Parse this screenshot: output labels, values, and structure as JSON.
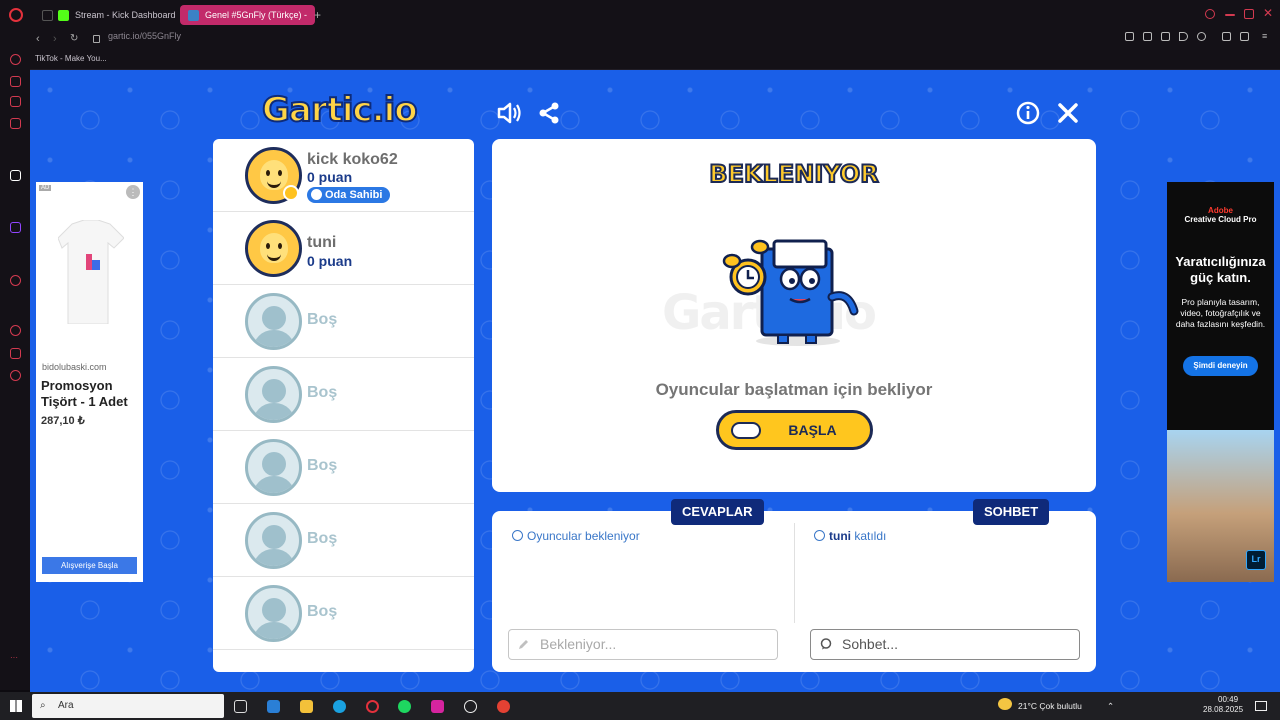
{
  "browser": {
    "tabs": [
      {
        "label": "Stream - Kick Dashboard",
        "favicon_color": "#53fc18"
      },
      {
        "label": "Genel #5GnFly (Türkçe) -",
        "favicon_color": "#3b82c6",
        "active": true
      }
    ],
    "url": "gartic.io/055GnFly",
    "bookmark": "TikTok - Make You..."
  },
  "game": {
    "logo_main": "Gartic",
    "logo_suffix": ".io",
    "players": [
      {
        "name": "kick koko62",
        "points": "0 puan",
        "badge": "Oda Sahibi"
      },
      {
        "name": "tuni",
        "points": "0 puan"
      }
    ],
    "empty_slot_label": "Boş",
    "status_title": "BEKLENIYOR",
    "waiting_text": "Oyuncular başlatman için bekliyor",
    "start_button": "BAŞLA",
    "answers_tab": "CEVAPLAR",
    "chat_tab": "SOHBET",
    "answers_info": "Oyuncular bekleniyor",
    "chat_info_user": "tuni",
    "chat_info_text": "katıldı",
    "answers_placeholder": "Bekleniyor...",
    "chat_placeholder": "Sohbet..."
  },
  "ads": {
    "left": {
      "tag": "AD",
      "brand": "bidolubaski.com",
      "title": "Promosyon Tişört - 1 Adet",
      "price": "287,10 ₺",
      "cta": "Alışverişe Başla"
    },
    "right": {
      "brand": "Adobe",
      "product": "Creative Cloud Pro",
      "headline": "Yaratıcılığınıza güç katın.",
      "body": "Pro planıyla tasarım, video, fotoğrafçılık ve daha fazlasını keşfedin.",
      "cta": "Şimdi deneyin",
      "badge": "Lr"
    }
  },
  "taskbar": {
    "search_placeholder": "Ara",
    "weather": "21°C  Çok bulutlu",
    "time": "00:49",
    "date": "28.08.2025"
  },
  "colors": {
    "game_bg": "#1a5fe8",
    "accent_yellow": "#ffc61e",
    "navy": "#0f2a7a"
  }
}
